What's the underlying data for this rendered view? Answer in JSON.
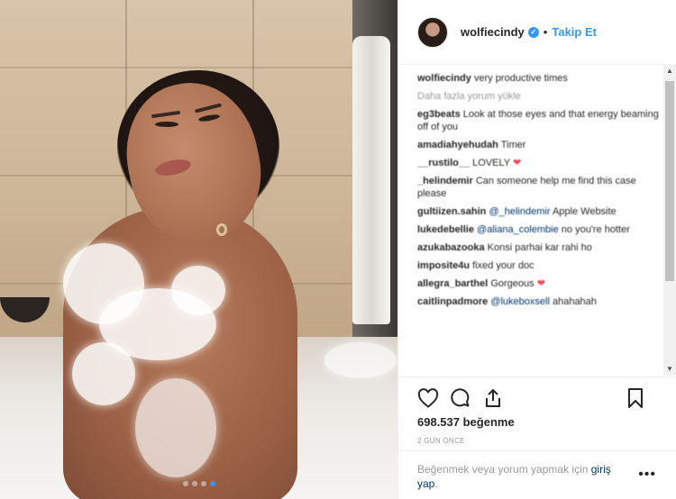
{
  "post": {
    "dot_count": 4,
    "active_dot": 3
  },
  "header": {
    "username": "wolfiecindy",
    "separator": "•",
    "follow_label": "Takip Et"
  },
  "comments": [
    {
      "user": "wolfiecindy",
      "text": "very productive times"
    },
    {
      "more": "Daha fazla yorum yükle"
    },
    {
      "user": "eg3beats",
      "text": "Look at those eyes and that energy beaming off of you"
    },
    {
      "user": "amadiahyehudah",
      "text": "Timer"
    },
    {
      "user": "__rustilo__",
      "text": "LOVELY",
      "heart": "❤"
    },
    {
      "user": "_helindemir",
      "text": "Can someone help me find this case please"
    },
    {
      "user": "gultiizen.sahin",
      "mention": "@_helindemir",
      "text": "Apple Website"
    },
    {
      "user": "lukedebellie",
      "mention": "@aliana_colembie",
      "text": "no you're hotter"
    },
    {
      "user": "azukabazooka",
      "text": "Konsi parhai kar rahi ho"
    },
    {
      "user": "imposite4u",
      "text": "fixed your doc"
    },
    {
      "user": "allegra_barthel",
      "text": "Gorgeous",
      "heart": "❤"
    },
    {
      "user": "caitlinpadmore",
      "mention": "@lukeboxsell",
      "text": "ahahahah"
    }
  ],
  "likes": "698.537 beğenme",
  "date": "2 GÜN ÖNCE",
  "login": {
    "prefix": "Beğenmek veya yorum yapmak için ",
    "link": "giriş yap",
    "suffix": "."
  },
  "more_options": "•••"
}
